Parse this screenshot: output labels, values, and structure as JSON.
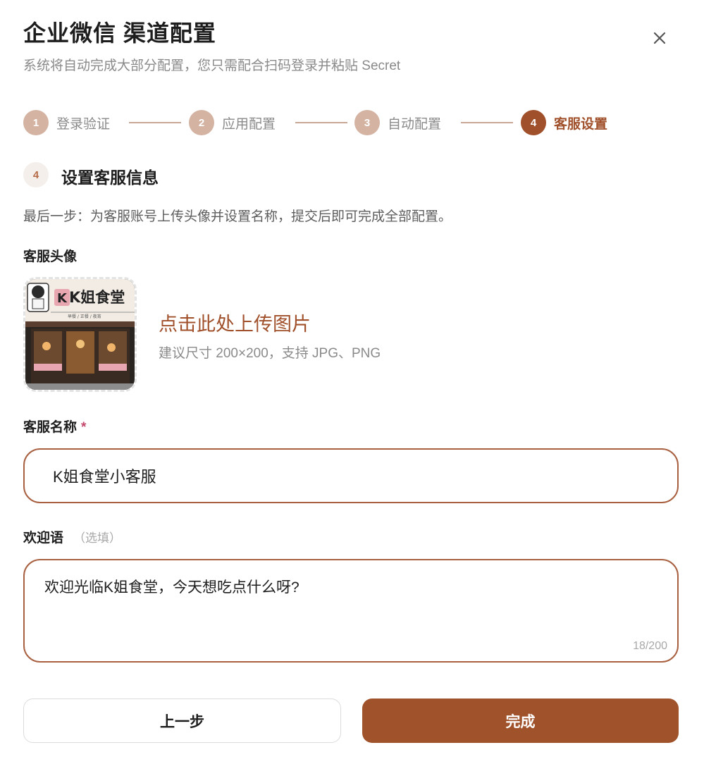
{
  "header": {
    "title": "企业微信 渠道配置",
    "subtitle": "系统将自动完成大部分配置，您只需配合扫码登录并粘贴 Secret",
    "close_icon": "close-icon"
  },
  "stepper": {
    "steps": [
      {
        "number": "1",
        "label": "登录验证",
        "state": "done"
      },
      {
        "number": "2",
        "label": "应用配置",
        "state": "done"
      },
      {
        "number": "3",
        "label": "自动配置",
        "state": "done"
      },
      {
        "number": "4",
        "label": "客服设置",
        "state": "active"
      }
    ]
  },
  "section": {
    "number": "4",
    "title": "设置客服信息",
    "description": "最后一步：为客服账号上传头像并设置名称，提交后即可完成全部配置。"
  },
  "avatar": {
    "label": "客服头像",
    "image_sign": "K姐食堂",
    "image_sign_sub": "早餐 / 正餐 / 夜宵",
    "upload_text": "点击此处上传图片",
    "upload_hint": "建议尺寸 200×200，支持 JPG、PNG"
  },
  "name_field": {
    "label": "客服名称",
    "required_mark": "*",
    "value": "K姐食堂小客服"
  },
  "welcome_field": {
    "label": "欢迎语",
    "optional_note": "（选填）",
    "value": "欢迎光临K姐食堂，今天想吃点什么呀?",
    "counter": "18/200"
  },
  "buttons": {
    "prev_label": "上一步",
    "done_label": "完成"
  },
  "colors": {
    "accent": "#a0502a",
    "step_done": "#d4b3a2",
    "border": "#a86040"
  }
}
